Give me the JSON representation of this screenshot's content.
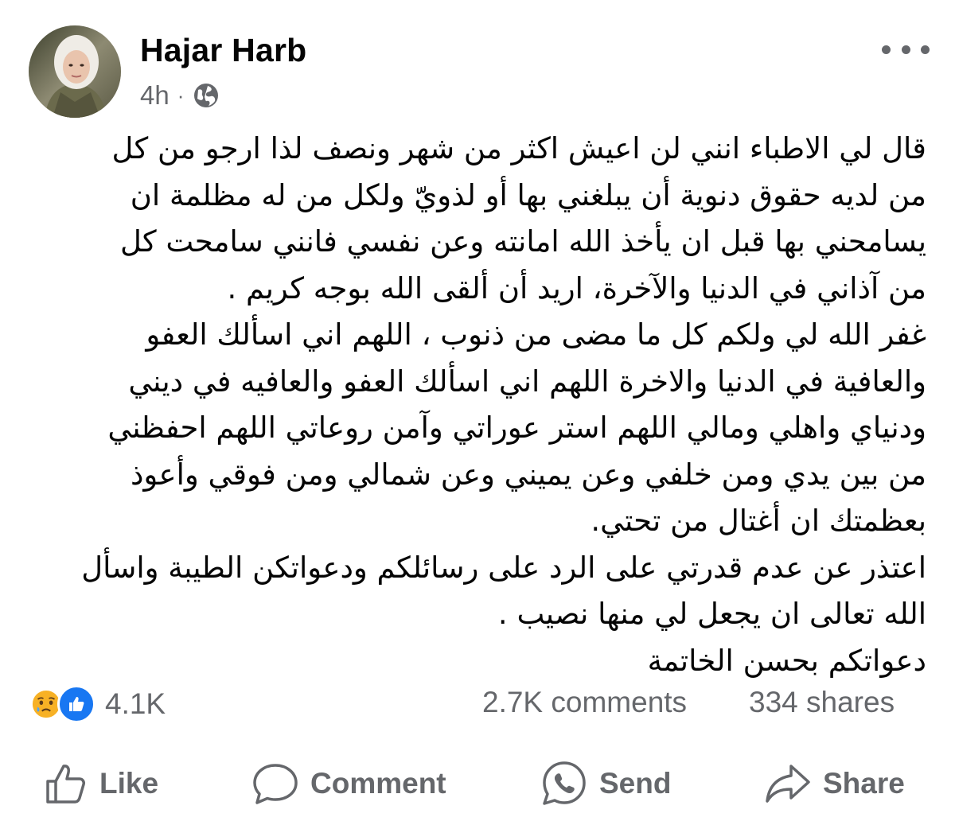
{
  "post": {
    "author": "Hajar Harb",
    "time": "4h",
    "separator": "·",
    "audience_icon": "globe-icon",
    "menu_icon": "more-dots-icon",
    "text_lines": [
      "قال لي الاطباء انني لن اعيش اكثر من شهر ونصف لذا ارجو من كل",
      "من لديه حقوق دنوية أن يبلغني  بها أو   لذويّ ولكل من له مظلمة ان",
      "يسامحني بها قبل ان يأخذ الله امانته وعن نفسي فانني سامحت كل",
      "من  آذاني  في الدنيا والآخرة، اريد أن ألقى الله بوجه كريم .",
      "غفر الله لي ولكم كل ما مضى من ذنوب ، اللهم اني اسألك العفو",
      "والعافية في الدنيا والاخرة اللهم اني اسألك العفو والعافيه في ديني",
      "ودنياي واهلي ومالي اللهم استر عوراتي وآمن روعاتي اللهم احفظني",
      "من بين يدي ومن خلفي وعن يميني وعن شمالي ومن فوقي وأعوذ",
      "بعظمتك ان أغتال من تحتي.",
      "اعتذر عن عدم قدرتي على الرد على رسائلكم ودعواتكن الطيبة واسأل",
      "الله تعالى ان  يجعل لي منها نصيب .",
      "دعواتكم بحسن الخاتمة"
    ]
  },
  "stats": {
    "reaction_icons": [
      "sad-reaction-icon",
      "like-reaction-icon"
    ],
    "reactions_count": "4.1K",
    "comments": "2.7K comments",
    "shares": "334 shares"
  },
  "actions": {
    "like": "Like",
    "comment": "Comment",
    "send": "Send",
    "share": "Share"
  },
  "colors": {
    "text_primary": "#050505",
    "text_secondary": "#65676b",
    "like_blue": "#1877f2",
    "sad_yellow": "#f7b125"
  }
}
